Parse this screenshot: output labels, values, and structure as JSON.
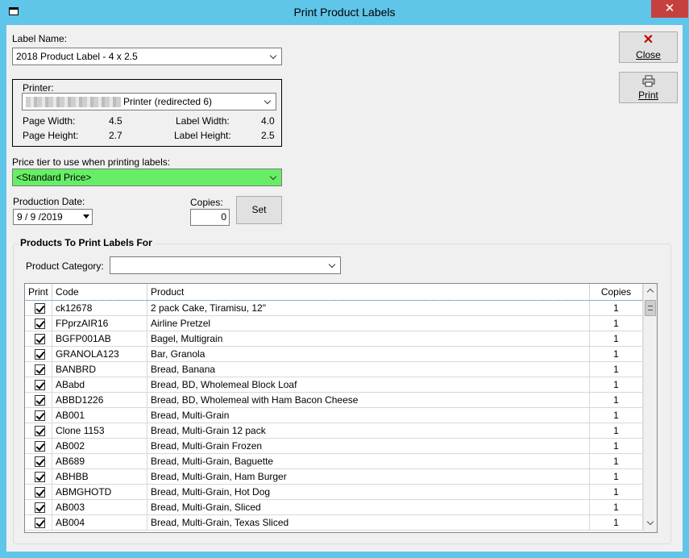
{
  "window": {
    "title": "Print Product Labels",
    "close_glyph": "✕"
  },
  "label_name": {
    "label": "Label Name:",
    "value": "2018 Product Label - 4 x 2.5"
  },
  "printer_box": {
    "label": "Printer:",
    "value": "Printer (redirected 6)",
    "page_width_label": "Page Width:",
    "page_width": "4.5",
    "page_height_label": "Page Height:",
    "page_height": "2.7",
    "label_width_label": "Label Width:",
    "label_width": "4.0",
    "label_height_label": "Label Height:",
    "label_height": "2.5"
  },
  "price_tier": {
    "label": "Price tier to use when printing labels:",
    "value": "<Standard Price>",
    "bg_color": "#66ee66"
  },
  "production_date": {
    "label": "Production Date:",
    "value": "9 / 9 /2019"
  },
  "copies": {
    "label": "Copies:",
    "value": "0"
  },
  "buttons": {
    "set": "Set",
    "close": "Close",
    "print": "Print"
  },
  "products": {
    "group_label": "Products To Print Labels For",
    "category_label": "Product Category:",
    "category_value": "",
    "columns": [
      "Print",
      "Code",
      "Product",
      "Copies"
    ],
    "rows": [
      {
        "code": "ck12678",
        "product": "2 pack Cake, Tiramisu, 12\"",
        "copies": "1"
      },
      {
        "code": "FPprzAIR16",
        "product": "Airline Pretzel",
        "copies": "1"
      },
      {
        "code": "BGFP001AB",
        "product": "Bagel, Multigrain",
        "copies": "1"
      },
      {
        "code": "GRANOLA123",
        "product": "Bar, Granola",
        "copies": "1"
      },
      {
        "code": "BANBRD",
        "product": "Bread, Banana",
        "copies": "1"
      },
      {
        "code": "ABabd",
        "product": "Bread, BD, Wholemeal Block Loaf",
        "copies": "1"
      },
      {
        "code": "ABBD1226",
        "product": "Bread, BD, Wholemeal with Ham Bacon Cheese",
        "copies": "1"
      },
      {
        "code": "AB001",
        "product": "Bread, Multi-Grain",
        "copies": "1"
      },
      {
        "code": "Clone 1153",
        "product": "Bread, Multi-Grain 12 pack",
        "copies": "1"
      },
      {
        "code": "AB002",
        "product": "Bread, Multi-Grain Frozen",
        "copies": "1"
      },
      {
        "code": "AB689",
        "product": "Bread, Multi-Grain, Baguette",
        "copies": "1"
      },
      {
        "code": "ABHBB",
        "product": "Bread, Multi-Grain, Ham Burger",
        "copies": "1"
      },
      {
        "code": "ABMGHOTD",
        "product": "Bread, Multi-Grain, Hot Dog",
        "copies": "1"
      },
      {
        "code": "AB003",
        "product": "Bread, Multi-Grain, Sliced",
        "copies": "1"
      },
      {
        "code": "AB004",
        "product": "Bread, Multi-Grain, Texas Sliced",
        "copies": "1"
      }
    ]
  }
}
